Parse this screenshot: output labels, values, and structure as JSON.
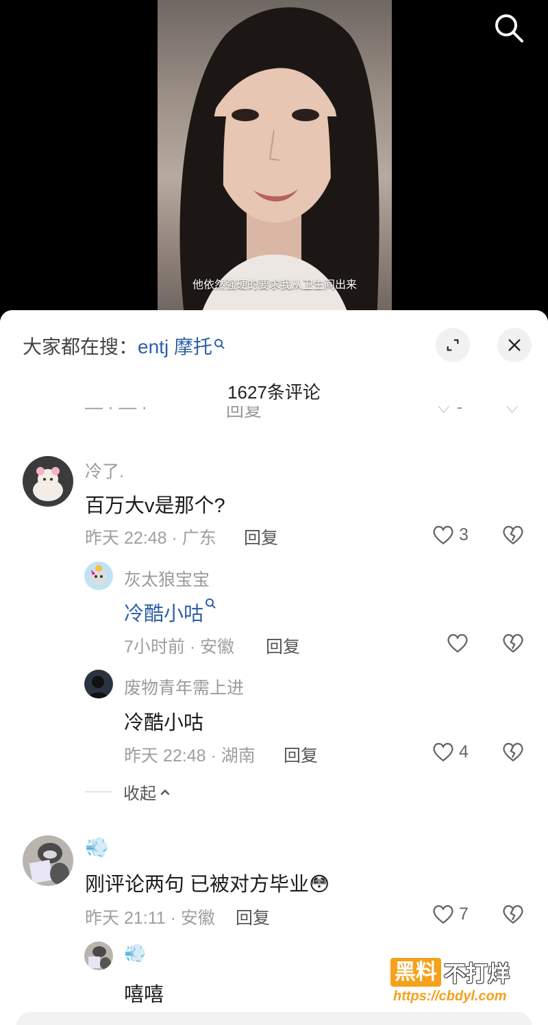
{
  "video": {
    "subtitle": "他依然强硬的要求我从卫生间出来"
  },
  "sheet": {
    "hot_search_prefix": "大家都在搜：",
    "hot_search_keyword": "entj 摩托",
    "comment_count": "1627条评论"
  },
  "comments": [
    {
      "username": "冷了.",
      "text": "百万大v是那个?",
      "time_location": "昨天 22:48 · 广东",
      "reply_label": "回复",
      "likes": "3",
      "replies": [
        {
          "username": "灰太狼宝宝",
          "text": "冷酷小咕",
          "time_location": "7小时前 · 安徽",
          "reply_label": "回复",
          "likes": ""
        },
        {
          "username": "废物青年需上进",
          "text": "冷酷小咕",
          "time_location": "昨天 22:48 · 湖南",
          "reply_label": "回复",
          "likes": "4"
        }
      ],
      "collapse_label": "收起"
    },
    {
      "username": "💨",
      "text": "刚评论两句  已被对方毕业😳",
      "time_location": "昨天 21:11 · 安徽",
      "reply_label": "回复",
      "likes": "7",
      "replies": [
        {
          "username": "💨",
          "text": "嘻嘻"
        }
      ]
    }
  ],
  "watermark": {
    "badge": "黑料",
    "rest": "不打烊",
    "url": "https://cbdyl.com"
  },
  "colors": {
    "link": "#2d5fa8",
    "muted": "#9a9a9a",
    "watermark_orange": "#f5a11b"
  }
}
